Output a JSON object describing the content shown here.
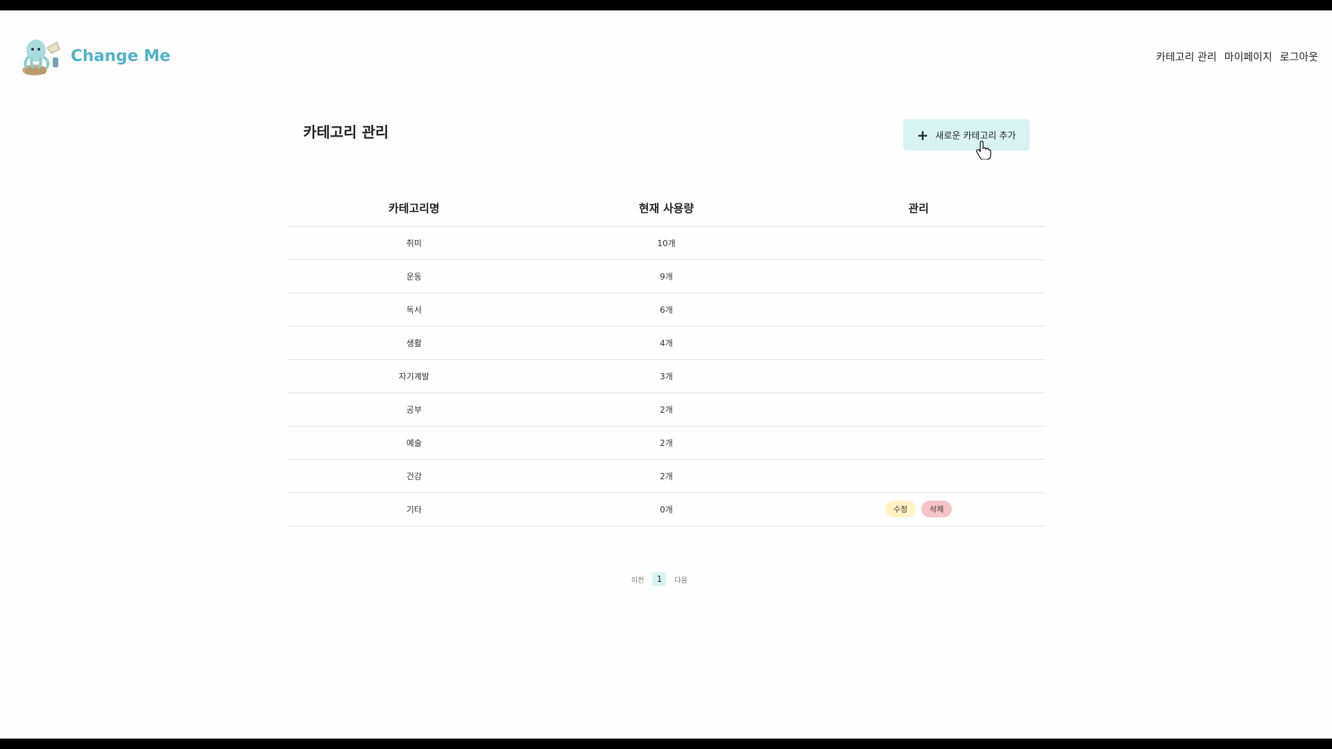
{
  "brand": {
    "name": "Change Me",
    "logo": "octopus-mascot"
  },
  "nav": {
    "categories": "카테고리 관리",
    "mypage": "마이페이지",
    "logout": "로그아웃"
  },
  "main": {
    "title": "카테고리 관리",
    "add_button": {
      "icon": "plus-icon",
      "label": "새로운 카테고리 추가"
    }
  },
  "table": {
    "headers": {
      "name": "카테고리명",
      "usage": "현재 사용량",
      "manage": "관리"
    },
    "rows": [
      {
        "name": "취미",
        "usage": "10개"
      },
      {
        "name": "운동",
        "usage": "9개"
      },
      {
        "name": "독서",
        "usage": "6개"
      },
      {
        "name": "생활",
        "usage": "4개"
      },
      {
        "name": "자기계발",
        "usage": "3개"
      },
      {
        "name": "공부",
        "usage": "2개"
      },
      {
        "name": "예술",
        "usage": "2개"
      },
      {
        "name": "건강",
        "usage": "2개"
      },
      {
        "name": "기타",
        "usage": "0개",
        "edit": "수정",
        "delete": "삭제"
      }
    ]
  },
  "pagination": {
    "prev": "이전",
    "current": "1",
    "next": "다음"
  },
  "colors": {
    "accent": "#d9f3f3",
    "brand": "#4fb3c8",
    "edit": "#fff3c4",
    "delete": "#f6c3c6"
  }
}
